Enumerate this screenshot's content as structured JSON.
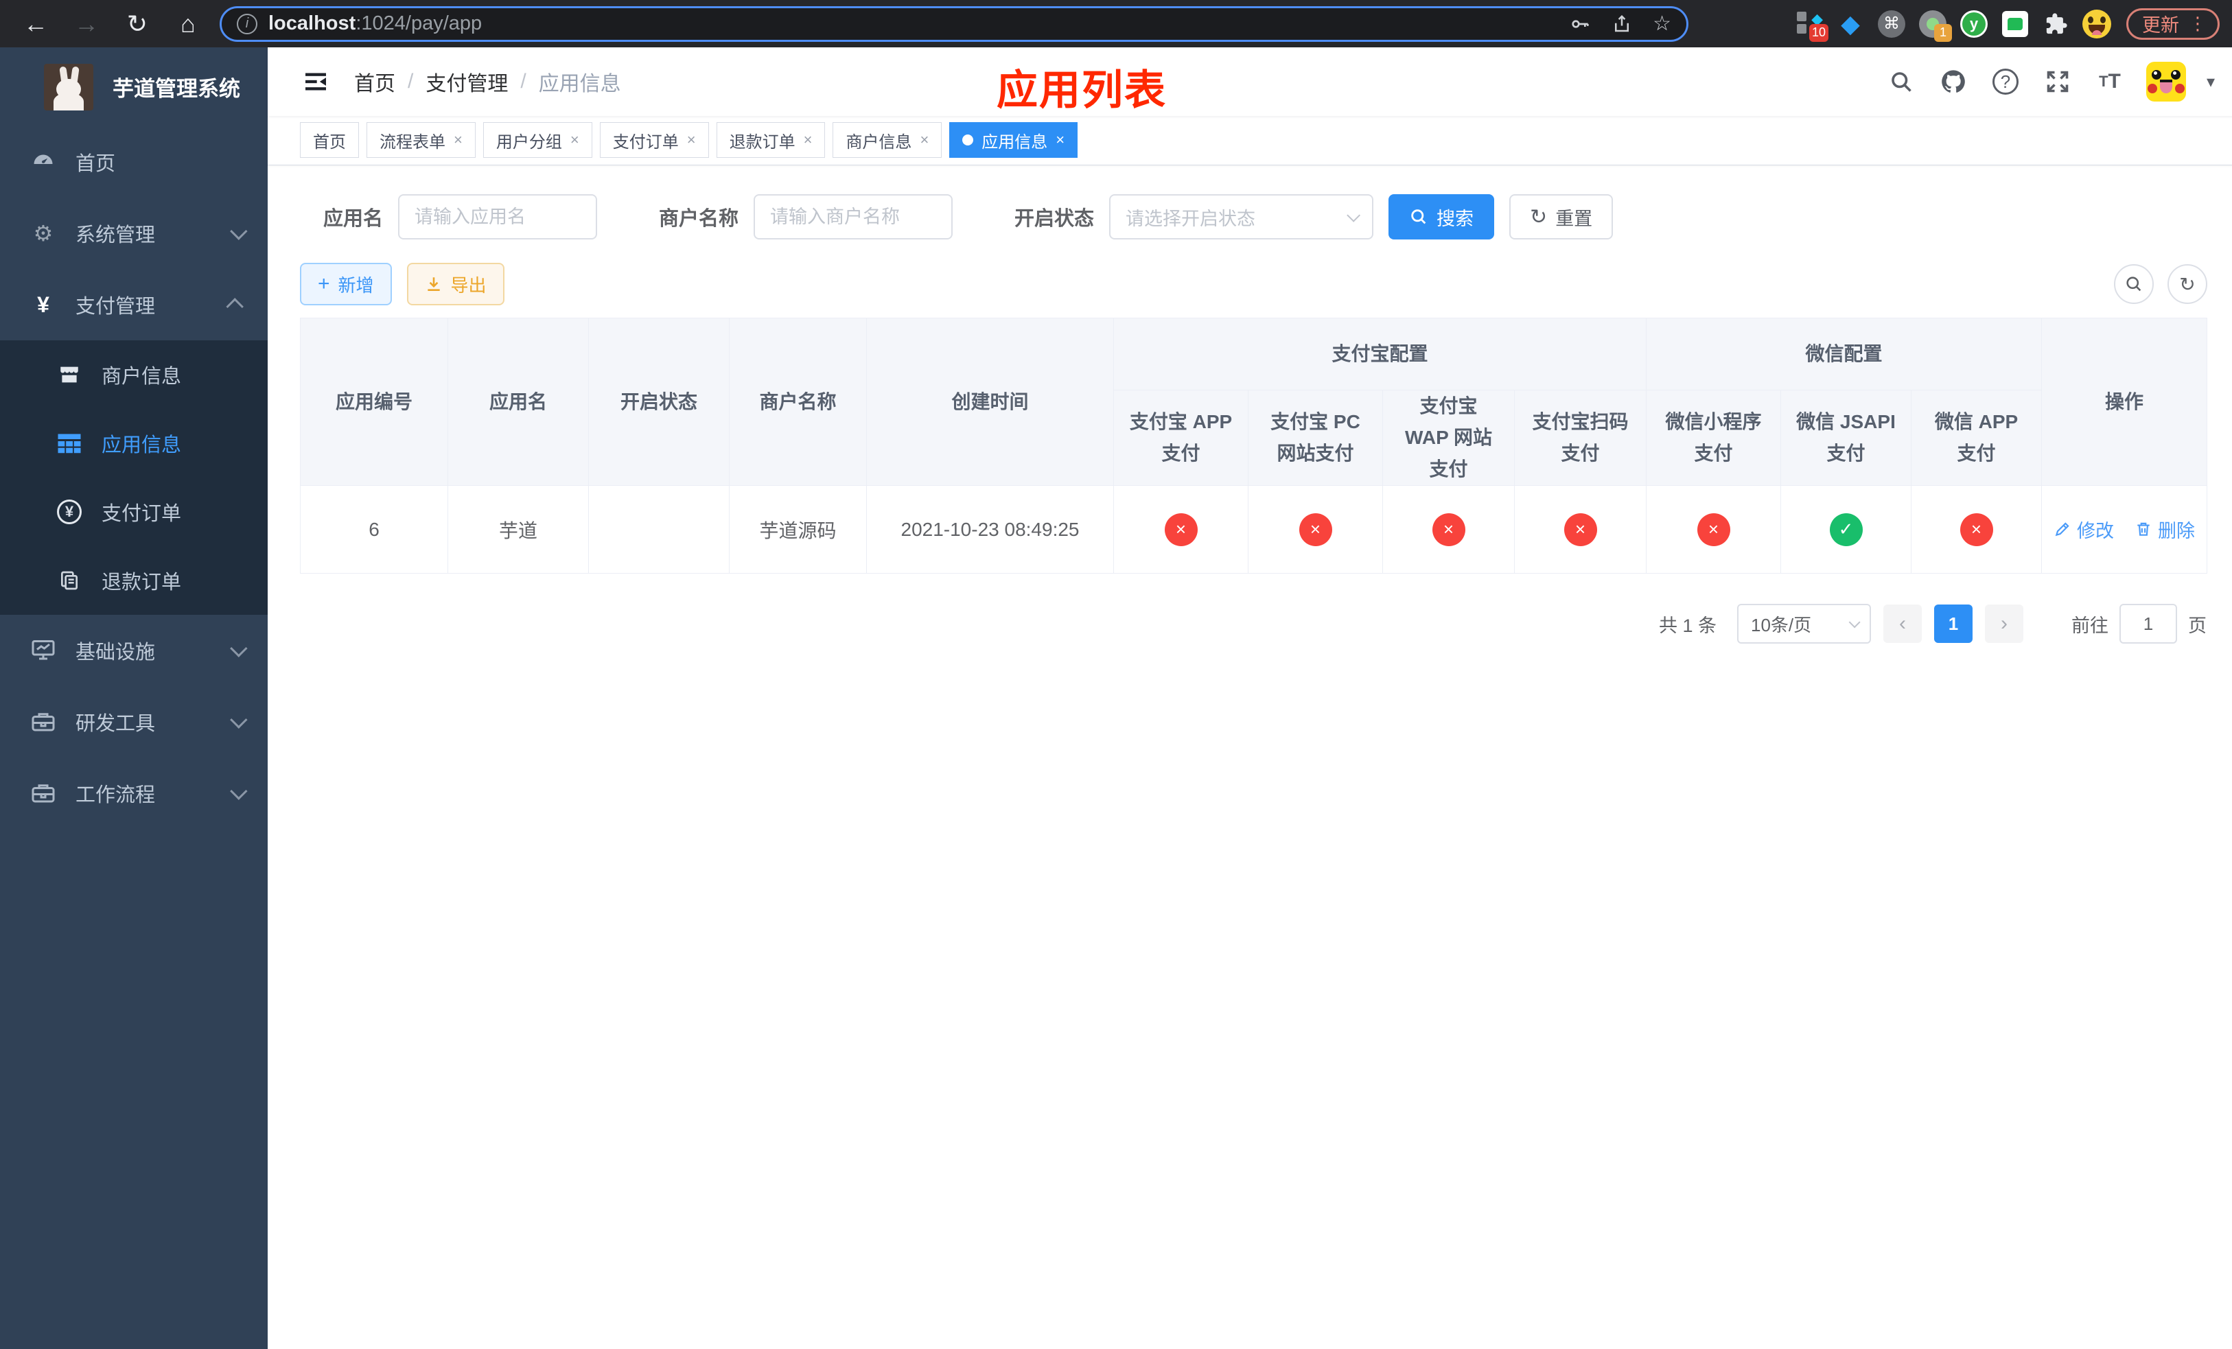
{
  "colors": {
    "accent_blue": "#2d8ff5",
    "sidebar_bg": "#304156",
    "submenu_bg": "#1f2d3d",
    "status_red": "#f8433c",
    "status_green": "#19be6b",
    "warning_orange": "#eca62a",
    "annotation_red": "#ff2800"
  },
  "browser": {
    "url_host": "localhost",
    "url_rest": ":1024/pay/app",
    "update_button": "更新",
    "menu_dots": "⋮",
    "ext_tiles_badge": "10",
    "ext_session_badge": "1",
    "ext_y_label": "y"
  },
  "sidebar": {
    "title": "芋道管理系统",
    "items": [
      {
        "label": "首页"
      },
      {
        "label": "系统管理"
      },
      {
        "label": "支付管理"
      },
      {
        "label": "商户信息"
      },
      {
        "label": "应用信息"
      },
      {
        "label": "支付订单"
      },
      {
        "label": "退款订单"
      },
      {
        "label": "基础设施"
      },
      {
        "label": "研发工具"
      },
      {
        "label": "工作流程"
      }
    ]
  },
  "header": {
    "breadcrumb": [
      "首页",
      "支付管理",
      "应用信息"
    ],
    "separator": "/",
    "annotation": "应用列表"
  },
  "tabs": [
    {
      "label": "首页"
    },
    {
      "label": "流程表单"
    },
    {
      "label": "用户分组"
    },
    {
      "label": "支付订单"
    },
    {
      "label": "退款订单"
    },
    {
      "label": "商户信息"
    },
    {
      "label": "应用信息"
    }
  ],
  "filters": {
    "app_name_label": "应用名",
    "app_name_placeholder": "请输入应用名",
    "merchant_label": "商户名称",
    "merchant_placeholder": "请输入商户名称",
    "status_label": "开启状态",
    "status_placeholder": "请选择开启状态",
    "search_button": "搜索",
    "reset_button": "重置"
  },
  "toolbar": {
    "add_button": "新增",
    "export_button": "导出"
  },
  "table": {
    "simple_columns": [
      "应用编号",
      "应用名",
      "开启状态",
      "商户名称",
      "创建时间"
    ],
    "group1_label": "支付宝配置",
    "group1_cols": [
      "支付宝 APP 支付",
      "支付宝 PC 网站支付",
      "支付宝 WAP 网站支付",
      "支付宝扫码支付"
    ],
    "group2_label": "微信配置",
    "group2_cols": [
      "微信小程序支付",
      "微信 JSAPI 支付",
      "微信 APP 支付"
    ],
    "op_column": "操作",
    "row": {
      "id": "6",
      "name": "芋道",
      "enabled": true,
      "merchant": "芋道源码",
      "created": "2021-10-23 08:49:25",
      "channels": [
        "disabled",
        "disabled",
        "disabled",
        "disabled",
        "disabled",
        "enabled",
        "disabled"
      ],
      "edit": "修改",
      "delete": "删除"
    }
  },
  "pagination": {
    "total": "共 1 条",
    "page_size": "10条/页",
    "current_page": "1",
    "goto_label": "前往",
    "goto_value": "1",
    "page_label": "页"
  }
}
